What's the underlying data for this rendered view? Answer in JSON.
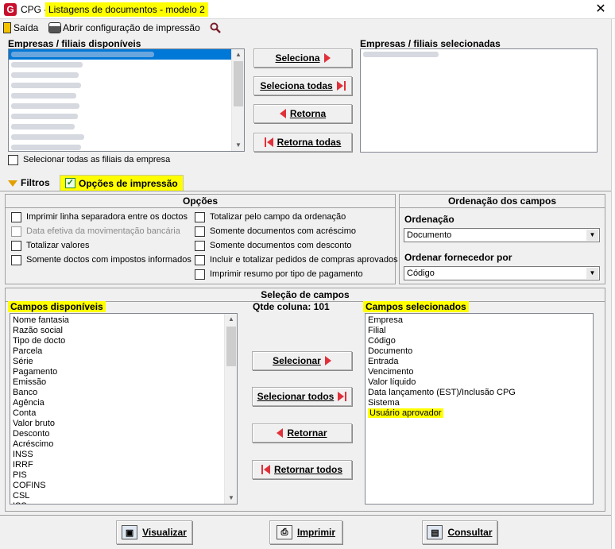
{
  "window": {
    "app_prefix": "CPG -",
    "title": "Listagens de documentos - modelo 2",
    "close_glyph": "✕",
    "logo_letter": "G"
  },
  "menu": {
    "exit_label": "Saída",
    "print_config_label": "Abrir configuração de impressão",
    "search_icon": "magnifier-icon"
  },
  "companies": {
    "available_label": "Empresas / filiais disponíveis",
    "selected_label": "Empresas / filiais selecionadas",
    "select_all_branches_label": "Selecionar todas as filiais da empresa",
    "select_all_branches_checked": false
  },
  "transfer_buttons": {
    "select": "Seleciona",
    "select_all": "Seleciona todas",
    "return": "Retorna",
    "return_all": "Retorna todas"
  },
  "tabs": {
    "filters": "Filtros",
    "print_options": "Opções de impressão"
  },
  "options": {
    "header": "Opções",
    "left": [
      {
        "label": "Imprimir linha separadora entre os doctos",
        "checked": false,
        "disabled": false
      },
      {
        "label": "Data efetiva da movimentação bancária",
        "checked": false,
        "disabled": true
      },
      {
        "label": "Totalizar valores",
        "checked": false,
        "disabled": false
      },
      {
        "label": "Somente doctos com impostos informados",
        "checked": false,
        "disabled": false
      }
    ],
    "right": [
      {
        "label": "Totalizar pelo campo da ordenação",
        "checked": false,
        "disabled": false
      },
      {
        "label": "Somente documentos com acréscimo",
        "checked": false,
        "disabled": false
      },
      {
        "label": "Somente documentos com desconto",
        "checked": false,
        "disabled": false
      },
      {
        "label": "Incluir e totalizar pedidos de compras aprovados",
        "checked": false,
        "disabled": false
      },
      {
        "label": "Imprimir resumo por tipo de pagamento",
        "checked": false,
        "disabled": false
      }
    ]
  },
  "ordering": {
    "header": "Ordenação dos campos",
    "order_label": "Ordenação",
    "order_value": "Documento",
    "supplier_order_label": "Ordenar fornecedor por",
    "supplier_order_value": "Código"
  },
  "fields": {
    "header": "Seleção de campos",
    "available_label": "Campos disponíveis",
    "column_count_label": "Qtde coluna: 101",
    "selected_label": "Campos selecionados",
    "available": [
      "Nome fantasia",
      "Razão social",
      "Tipo de docto",
      "Parcela",
      "Série",
      "Pagamento",
      "Emissão",
      "Banco",
      "Agência",
      "Conta",
      "Valor bruto",
      "Desconto",
      "Acréscimo",
      "INSS",
      "IRRF",
      "PIS",
      "COFINS",
      "CSL",
      "ISS"
    ],
    "selected": [
      "Empresa",
      "Filial",
      "Código",
      "Documento",
      "Entrada",
      "Vencimento",
      "Valor líquido",
      "Data lançamento (EST)/Inclusão CPG",
      "Sistema",
      "Usuário aprovador"
    ],
    "highlighted_selected": "Usuário aprovador",
    "buttons": {
      "select": "Selecionar",
      "select_all": "Selecionar todos",
      "return": "Retornar",
      "return_all": "Retornar todos"
    }
  },
  "footer": {
    "view": "Visualizar",
    "print": "Imprimir",
    "query": "Consultar"
  },
  "colors": {
    "highlight": "#ffff00",
    "selection": "#0078d7",
    "arrow_red": "#e0303a",
    "brand_red": "#c8102e"
  }
}
